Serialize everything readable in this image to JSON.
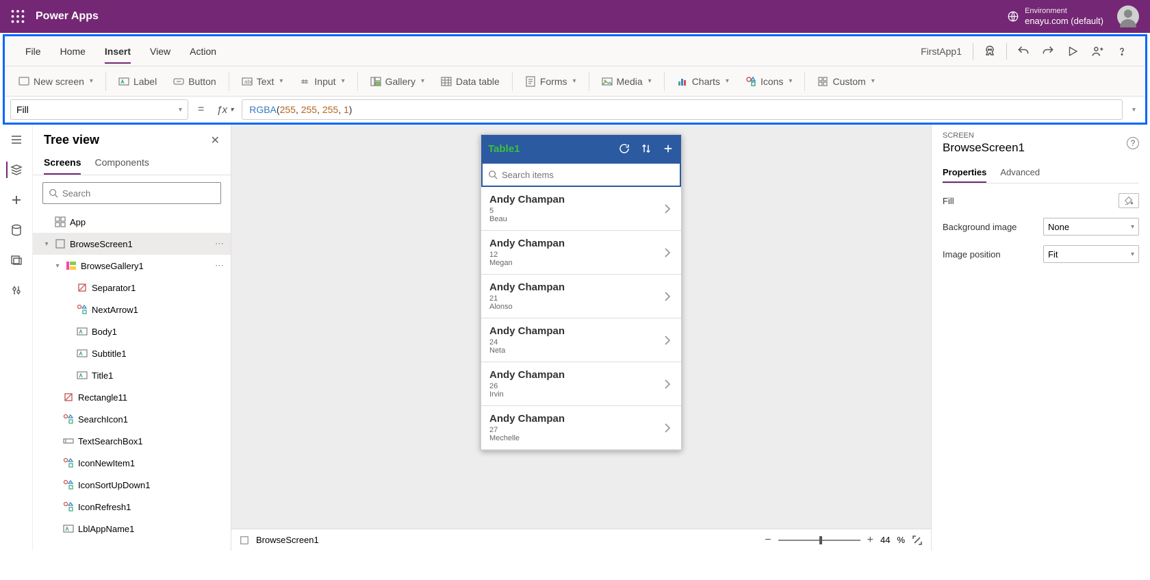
{
  "header": {
    "brand": "Power Apps",
    "env_label": "Environment",
    "env_name": "enayu.com (default)"
  },
  "menu": {
    "items": [
      "File",
      "Home",
      "Insert",
      "View",
      "Action"
    ],
    "active": "Insert",
    "app_name": "FirstApp1"
  },
  "ribbon": {
    "new_screen": "New screen",
    "label": "Label",
    "button": "Button",
    "text": "Text",
    "input": "Input",
    "gallery": "Gallery",
    "data_table": "Data table",
    "forms": "Forms",
    "media": "Media",
    "charts": "Charts",
    "icons": "Icons",
    "custom": "Custom"
  },
  "formula": {
    "property": "Fill",
    "fn": "RGBA",
    "args": [
      "255",
      "255",
      "255",
      "1"
    ]
  },
  "tree": {
    "title": "Tree view",
    "tabs": [
      "Screens",
      "Components"
    ],
    "search_placeholder": "Search",
    "app": "App",
    "items": [
      {
        "name": "BrowseScreen1"
      },
      {
        "name": "BrowseGallery1"
      },
      {
        "name": "Separator1"
      },
      {
        "name": "NextArrow1"
      },
      {
        "name": "Body1"
      },
      {
        "name": "Subtitle1"
      },
      {
        "name": "Title1"
      },
      {
        "name": "Rectangle11"
      },
      {
        "name": "SearchIcon1"
      },
      {
        "name": "TextSearchBox1"
      },
      {
        "name": "IconNewItem1"
      },
      {
        "name": "IconSortUpDown1"
      },
      {
        "name": "IconRefresh1"
      },
      {
        "name": "LblAppName1"
      }
    ]
  },
  "preview": {
    "title": "Table1",
    "search_placeholder": "Search items",
    "rows": [
      {
        "title": "Andy Champan",
        "sub": "5",
        "body": "Beau"
      },
      {
        "title": "Andy Champan",
        "sub": "12",
        "body": "Megan"
      },
      {
        "title": "Andy Champan",
        "sub": "21",
        "body": "Alonso"
      },
      {
        "title": "Andy Champan",
        "sub": "24",
        "body": "Neta"
      },
      {
        "title": "Andy Champan",
        "sub": "26",
        "body": "Irvin"
      },
      {
        "title": "Andy Champan",
        "sub": "27",
        "body": "Mechelle"
      }
    ]
  },
  "props": {
    "type": "SCREEN",
    "name": "BrowseScreen1",
    "tabs": [
      "Properties",
      "Advanced"
    ],
    "fill": "Fill",
    "bg_image": "Background image",
    "bg_image_val": "None",
    "img_pos": "Image position",
    "img_pos_val": "Fit"
  },
  "status": {
    "screen": "BrowseScreen1",
    "zoom": "44",
    "pct": "%"
  }
}
